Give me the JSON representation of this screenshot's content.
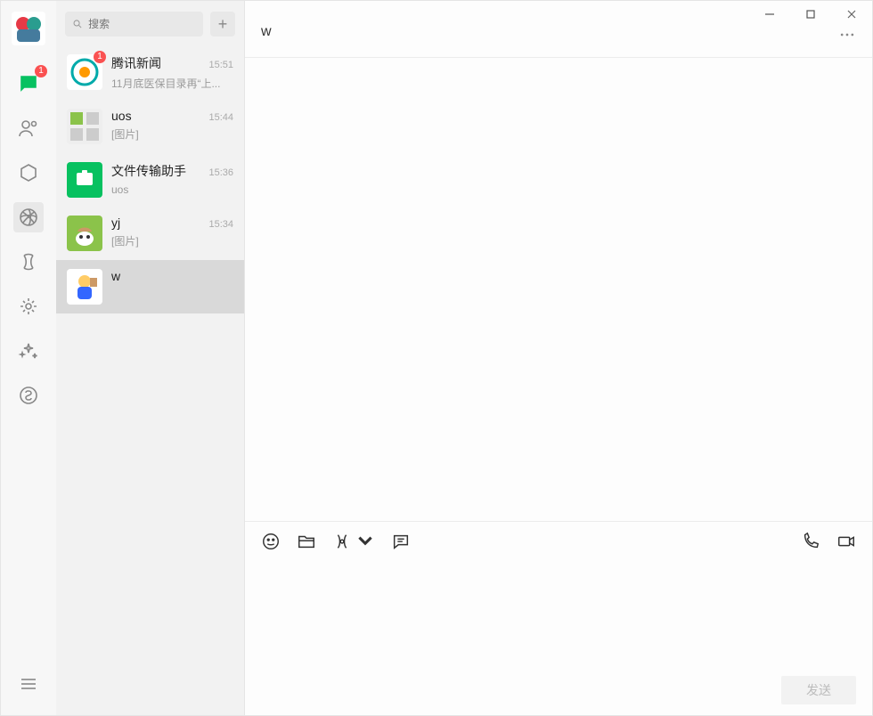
{
  "nav": {
    "chat_badge": "1"
  },
  "search": {
    "placeholder": "搜索",
    "add_label": "+"
  },
  "conversations": [
    {
      "name": "腾讯新闻",
      "time": "15:51",
      "preview": "11月底医保目录再“上...",
      "badge": "1"
    },
    {
      "name": "uos",
      "time": "15:44",
      "preview": "[图片]"
    },
    {
      "name": "文件传输助手",
      "time": "15:36",
      "preview": "uos"
    },
    {
      "name": "yj",
      "time": "15:34",
      "preview": "[图片]"
    },
    {
      "name": "w",
      "time": "",
      "preview": ""
    }
  ],
  "chat": {
    "title": "w",
    "send_label": "发送"
  }
}
